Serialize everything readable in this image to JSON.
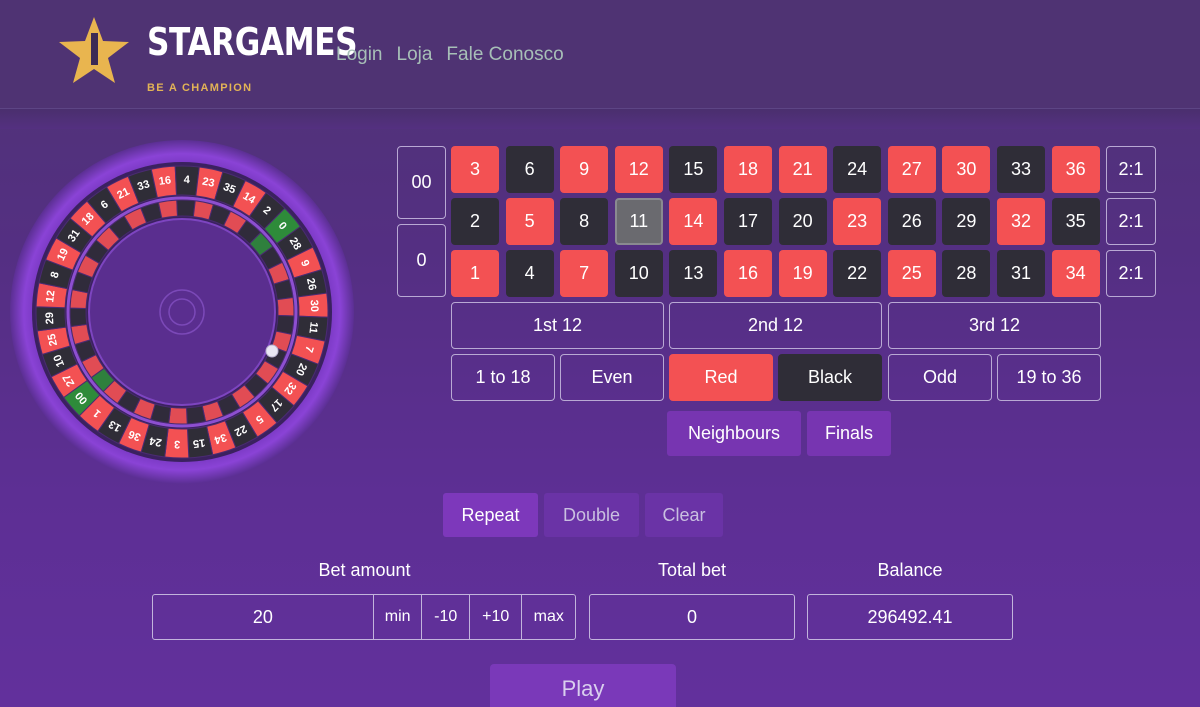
{
  "brand": {
    "name": "STARGAMES",
    "tagline": "BE A CHAMPION"
  },
  "nav": [
    {
      "label": "Login"
    },
    {
      "label": "Loja"
    },
    {
      "label": "Fale Conosco"
    }
  ],
  "wheel": {
    "sequence": [
      "0",
      "28",
      "9",
      "26",
      "30",
      "11",
      "7",
      "20",
      "32",
      "17",
      "5",
      "22",
      "34",
      "15",
      "3",
      "24",
      "36",
      "13",
      "1",
      "00",
      "27",
      "10",
      "25",
      "29",
      "12",
      "8",
      "19",
      "31",
      "18",
      "6",
      "21",
      "33",
      "16",
      "4",
      "23",
      "35",
      "14",
      "2"
    ],
    "colors": {
      "red": "#f35153",
      "black": "#2f2d37",
      "green": "#2e8b3a"
    }
  },
  "table": {
    "zeros": [
      "00",
      "0"
    ],
    "rows": [
      [
        {
          "n": "3",
          "c": "red"
        },
        {
          "n": "6",
          "c": "black"
        },
        {
          "n": "9",
          "c": "red"
        },
        {
          "n": "12",
          "c": "red"
        },
        {
          "n": "15",
          "c": "black"
        },
        {
          "n": "18",
          "c": "red"
        },
        {
          "n": "21",
          "c": "red"
        },
        {
          "n": "24",
          "c": "black"
        },
        {
          "n": "27",
          "c": "red"
        },
        {
          "n": "30",
          "c": "red"
        },
        {
          "n": "33",
          "c": "black"
        },
        {
          "n": "36",
          "c": "red"
        }
      ],
      [
        {
          "n": "2",
          "c": "black"
        },
        {
          "n": "5",
          "c": "red"
        },
        {
          "n": "8",
          "c": "black"
        },
        {
          "n": "11",
          "c": "selected"
        },
        {
          "n": "14",
          "c": "red"
        },
        {
          "n": "17",
          "c": "black"
        },
        {
          "n": "20",
          "c": "black"
        },
        {
          "n": "23",
          "c": "red"
        },
        {
          "n": "26",
          "c": "black"
        },
        {
          "n": "29",
          "c": "black"
        },
        {
          "n": "32",
          "c": "red"
        },
        {
          "n": "35",
          "c": "black"
        }
      ],
      [
        {
          "n": "1",
          "c": "red"
        },
        {
          "n": "4",
          "c": "black"
        },
        {
          "n": "7",
          "c": "red"
        },
        {
          "n": "10",
          "c": "black"
        },
        {
          "n": "13",
          "c": "black"
        },
        {
          "n": "16",
          "c": "red"
        },
        {
          "n": "19",
          "c": "red"
        },
        {
          "n": "22",
          "c": "black"
        },
        {
          "n": "25",
          "c": "red"
        },
        {
          "n": "28",
          "c": "black"
        },
        {
          "n": "31",
          "c": "black"
        },
        {
          "n": "34",
          "c": "red"
        }
      ]
    ],
    "column_bets": [
      "2:1",
      "2:1",
      "2:1"
    ],
    "dozens": [
      "1st 12",
      "2nd 12",
      "3rd 12"
    ],
    "outside": [
      "1 to 18",
      "Even",
      "Red",
      "Black",
      "Odd",
      "19 to 36"
    ],
    "special": [
      "Neighbours",
      "Finals"
    ]
  },
  "actions": {
    "repeat": "Repeat",
    "double": "Double",
    "clear": "Clear"
  },
  "bet": {
    "amount_label": "Bet amount",
    "amount_value": "20",
    "steppers": [
      "min",
      "-10",
      "+10",
      "max"
    ],
    "total_label": "Total bet",
    "total_value": "0",
    "balance_label": "Balance",
    "balance_value": "296492.41"
  },
  "play_label": "Play"
}
